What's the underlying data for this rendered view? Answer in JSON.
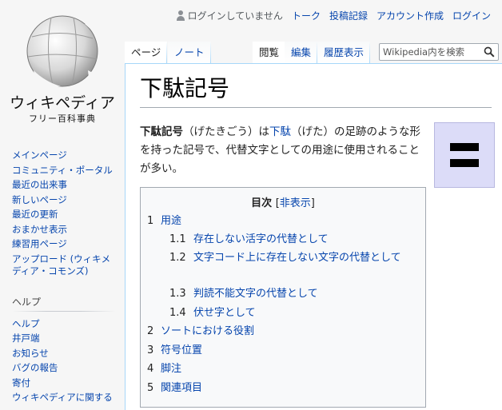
{
  "personal": {
    "not_logged_in": "ログインしていません",
    "talk": "トーク",
    "contributions": "投稿記録",
    "create_account": "アカウント作成",
    "login": "ログイン"
  },
  "logo": {
    "wordmark": "ウィキペディア",
    "tagline": "フリー百科事典"
  },
  "sidebar": {
    "navigation": [
      "メインページ",
      "コミュニティ・ポータル",
      "最近の出来事",
      "新しいページ",
      "最近の更新",
      "おまかせ表示",
      "練習用ページ",
      "アップロード (ウィキメディア・コモンズ)"
    ],
    "help_title": "ヘルプ",
    "help": [
      "ヘルプ",
      "井戸端",
      "お知らせ",
      "バグの報告",
      "寄付",
      "ウィキペディアに関する"
    ]
  },
  "tabs": {
    "page": "ページ",
    "note": "ノート",
    "read": "閲覧",
    "edit": "編集",
    "history": "履歴表示"
  },
  "search": {
    "placeholder": "Wikipedia内を検索"
  },
  "article": {
    "title": "下駄記号",
    "lead_bold": "下駄記号",
    "lead_1": "（げたきごう）は",
    "lead_link": "下駄",
    "lead_2": "（げた）の足跡のような形を持った記号で、代替文字としての用途に使用されることが多い。"
  },
  "toc": {
    "title": "目次",
    "toggle_open": "[",
    "toggle": "非表示",
    "toggle_close": "]",
    "items": [
      {
        "num": "1",
        "text": "用途",
        "level": 1
      },
      {
        "num": "1.1",
        "text": "存在しない活字の代替として",
        "level": 2
      },
      {
        "num": "1.2",
        "text": "文字コード上に存在しない文字の代替として",
        "level": 2
      },
      {
        "num": "1.3",
        "text": "判読不能文字の代替として",
        "level": 2
      },
      {
        "num": "1.4",
        "text": "伏せ字として",
        "level": 2
      },
      {
        "num": "2",
        "text": "ソートにおける役割",
        "level": 1
      },
      {
        "num": "3",
        "text": "符号位置",
        "level": 1
      },
      {
        "num": "4",
        "text": "脚注",
        "level": 1
      },
      {
        "num": "5",
        "text": "関連項目",
        "level": 1
      }
    ]
  },
  "colors": {
    "link": "#0645ad",
    "glyph_box": "#dcdcf8",
    "toc_bg": "#f8f9fa"
  }
}
